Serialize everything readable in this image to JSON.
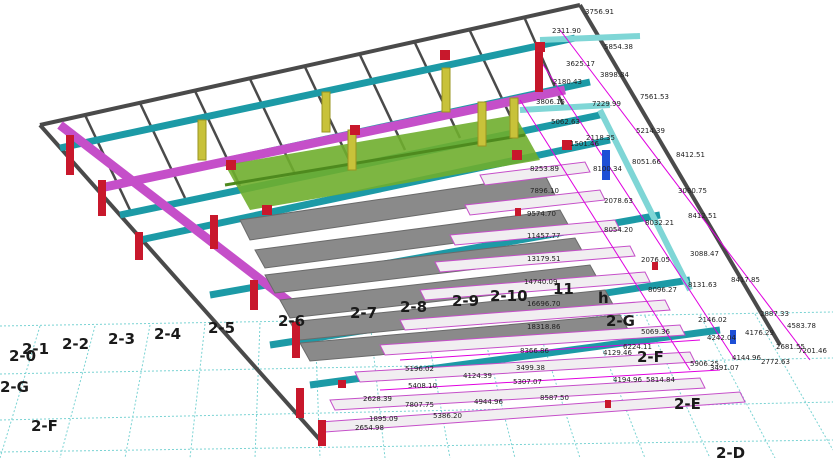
{
  "colors": {
    "background": "#ffffff",
    "ground_grid": "#7ad3d3",
    "roof_frame": "#4a4a4a",
    "purlin": "#1c9aa6",
    "truss_purple": "#c54fc9",
    "truss_green": "#6fae2e",
    "truss_gray": "#8a8a8a",
    "column_yellow": "#c8c23a",
    "column_red": "#c4162a",
    "column_blue": "#1d4fd6",
    "connection": "#c8182c",
    "dimension_line": "#e000e0"
  },
  "grid_labels": {
    "g_2_0": "2-0",
    "g_2_1": "2-1",
    "g_2_2": "2-2",
    "g_2_3": "2-3",
    "g_2_4": "2-4",
    "g_2_5": "2-5",
    "g_2_6": "2-6",
    "g_2_7": "2-7",
    "g_2_8": "2-8",
    "g_2_9": "2-9",
    "g_2_10": "2-10",
    "g_11": "11",
    "g_h": "h",
    "g_2_G_left": "2-G",
    "g_2_F_left": "2-F",
    "g_2_G_right": "2-G",
    "g_2_F_right": "2-F",
    "g_2_E": "2-E",
    "g_2_D": "2-D"
  },
  "dimensions": {
    "d01": "3756.91",
    "d02": "2311.90",
    "d03": "5854.38",
    "d04": "3625.17",
    "d05": "3898.84",
    "d06": "2180.43",
    "d07": "3806.15",
    "d08": "7229.99",
    "d09": "7561.53",
    "d10": "5062.63",
    "d11": "2118.35",
    "d12": "5214.39",
    "d13": "1501.46",
    "d14": "8412.51",
    "d15": "8051.66",
    "d16": "8253.89",
    "d17": "8100.34",
    "d18": "7896.10",
    "d19": "3080.75",
    "d20": "2078.63",
    "d21": "9574.70",
    "d22": "8032.21",
    "d23": "8412.51",
    "d24": "11457.77",
    "d25": "8054.20",
    "d26": "3088.47",
    "d27": "13179.51",
    "d28": "2076.05",
    "d29": "8417.85",
    "d30": "14740.09",
    "d31": "8131.63",
    "d32": "8096.27",
    "d33": "2887.33",
    "d34": "16696.70",
    "d35": "4583.78",
    "d36": "2146.02",
    "d37": "18318.86",
    "d38": "4176.29",
    "d39": "5069.36",
    "d40": "4242.04",
    "d41": "2681.55",
    "d42": "7201.46",
    "d43": "5196.02",
    "d44": "8366.86",
    "d45": "4129.46",
    "d46": "6224.11",
    "d47": "4144.96",
    "d48": "2772.63",
    "d49": "3499.38",
    "d50": "4124.39",
    "d51": "5906.25",
    "d52": "3491.07",
    "d53": "5408.10",
    "d54": "5307.07",
    "d55": "4194.96",
    "d56": "5814.84",
    "d57": "2628.39",
    "d58": "7807.75",
    "d59": "4944.96",
    "d60": "8587.50",
    "d61": "1895.09",
    "d62": "5386.20",
    "d63": "2654.98"
  }
}
